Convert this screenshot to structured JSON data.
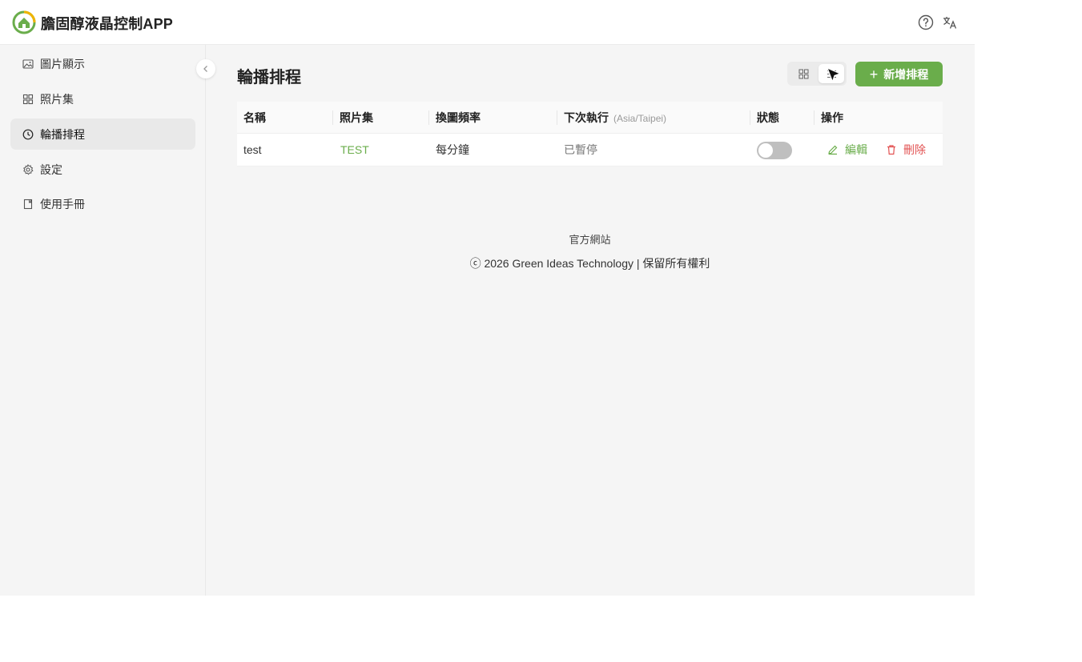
{
  "app": {
    "title": "膽固醇液晶控制APP",
    "accent_color": "#6aad4b",
    "danger_color": "#e25151"
  },
  "header": {
    "help_icon": "help-circle-icon",
    "lang_icon": "translate-icon"
  },
  "sidebar": {
    "items": [
      {
        "label": "圖片顯示",
        "icon": "image-icon",
        "active": false
      },
      {
        "label": "照片集",
        "icon": "grid-icon",
        "active": false
      },
      {
        "label": "輪播排程",
        "icon": "clock-icon",
        "active": true
      },
      {
        "label": "設定",
        "icon": "gear-icon",
        "active": false
      },
      {
        "label": "使用手冊",
        "icon": "book-icon",
        "active": false
      }
    ]
  },
  "main": {
    "title": "輪播排程",
    "add_button": "新增排程",
    "table": {
      "columns": [
        "名稱",
        "照片集",
        "換圖頻率",
        "下次執行",
        "狀態",
        "操作"
      ],
      "timezone": "(Asia/Taipei)",
      "rows": [
        {
          "name": "test",
          "album": "TEST",
          "frequency": "每分鐘",
          "next_run": "已暫停",
          "enabled": false,
          "edit": "編輯",
          "delete": "刪除"
        }
      ]
    }
  },
  "footer": {
    "link": "官方網站",
    "copyright": "ⓒ 2026 Green Ideas Technology | 保留所有權利"
  }
}
